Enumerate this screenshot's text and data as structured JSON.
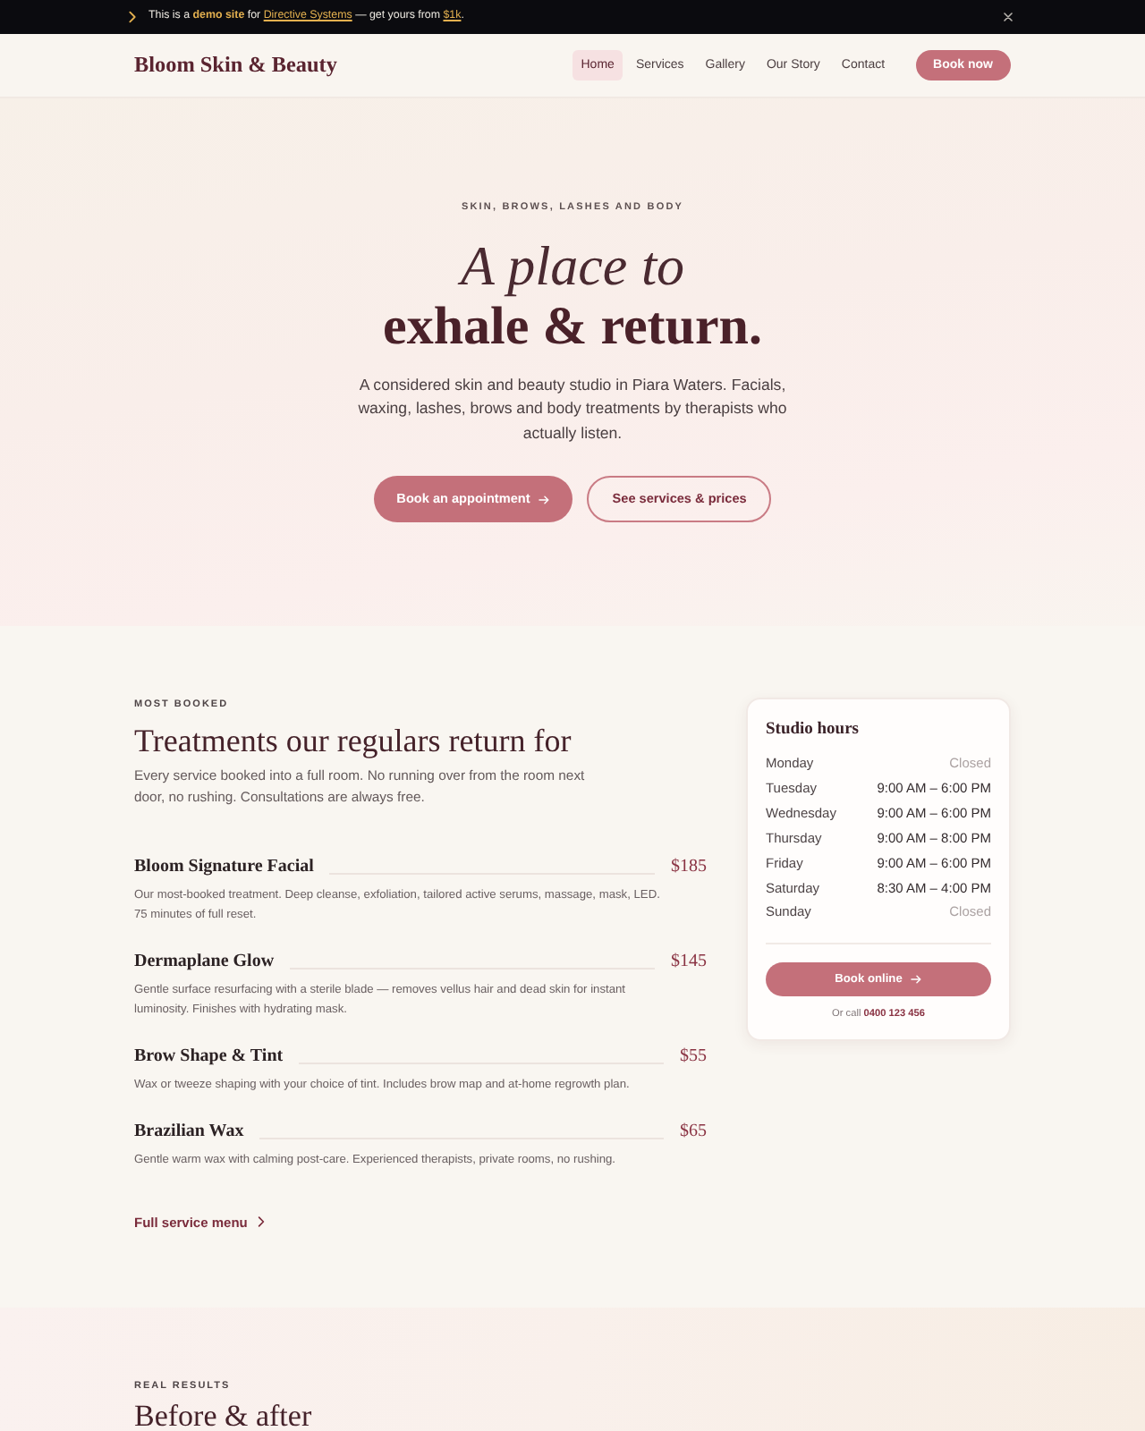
{
  "banner": {
    "segments": [
      {
        "kind": "text",
        "text": "This is a **demo site** for "
      },
      {
        "kind": "link",
        "text": "Directive Systems"
      },
      {
        "kind": "text",
        "text": " — get yours from "
      },
      {
        "kind": "link",
        "text": "$1k"
      },
      {
        "kind": "text",
        "text": "."
      }
    ]
  },
  "header": {
    "logo": "Bloom Skin & Beauty",
    "nav": [
      {
        "label": "Home",
        "selected": true
      },
      {
        "label": "Services",
        "selected": false
      },
      {
        "label": "Gallery",
        "selected": false
      },
      {
        "label": "Our Story",
        "selected": false
      },
      {
        "label": "Contact",
        "selected": false
      }
    ],
    "cta": "Book now"
  },
  "hero": {
    "eyebrow": "SKIN, BROWS, LASHES AND BODY",
    "title_line_1": "A place to",
    "title_line_2": "exhale & return.",
    "description": "A considered skin and beauty studio in Piara Waters. Facials, waxing, lashes, brows and body treatments by therapists who actually listen.",
    "buttons": [
      {
        "kind": "primary",
        "label": "Book an appointment"
      },
      {
        "kind": "secondary",
        "label": "See services & prices"
      }
    ]
  },
  "services": {
    "eyebrow": "MOST BOOKED",
    "title": "Treatments our regulars return for",
    "description": "Every service booked into a full room. No running over from the room next door, no rushing. Consultations are always free.",
    "items": [
      {
        "name": "Bloom Signature Facial",
        "price": "$185",
        "description": "Our most-booked treatment. Deep cleanse, exfoliation, tailored active serums, massage, mask, LED. 75 minutes of full reset."
      },
      {
        "name": "Dermaplane Glow",
        "price": "$145",
        "description": "Gentle surface resurfacing with a sterile blade — removes vellus hair and dead skin for instant luminosity. Finishes with hydrating mask."
      },
      {
        "name": "Brow Shape & Tint",
        "price": "$55",
        "description": "Wax or tweeze shaping with your choice of tint. Includes brow map and at-home regrowth plan."
      },
      {
        "name": "Brazilian Wax",
        "price": "$65",
        "description": "Gentle warm wax with calming post-care. Experienced therapists, private rooms, no rushing."
      }
    ],
    "link": "Full service menu"
  },
  "hours": {
    "title": "Studio hours",
    "rows": [
      {
        "day": "Monday",
        "time": "Closed",
        "closed": true
      },
      {
        "day": "Tuesday",
        "time": "9:00 AM – 6:00 PM",
        "closed": false
      },
      {
        "day": "Wednesday",
        "time": "9:00 AM – 6:00 PM",
        "closed": false
      },
      {
        "day": "Thursday",
        "time": "9:00 AM – 8:00 PM",
        "closed": false
      },
      {
        "day": "Friday",
        "time": "9:00 AM – 6:00 PM",
        "closed": false
      },
      {
        "day": "Saturday",
        "time": "8:30 AM – 4:00 PM",
        "closed": false
      },
      {
        "day": "Sunday",
        "time": "Closed",
        "closed": true
      }
    ],
    "button": "Book online",
    "call_prefix": "Or call",
    "phone": "0400 123 456"
  },
  "results": {
    "eyebrow": "REAL RESULTS",
    "title": "Before & after"
  }
}
